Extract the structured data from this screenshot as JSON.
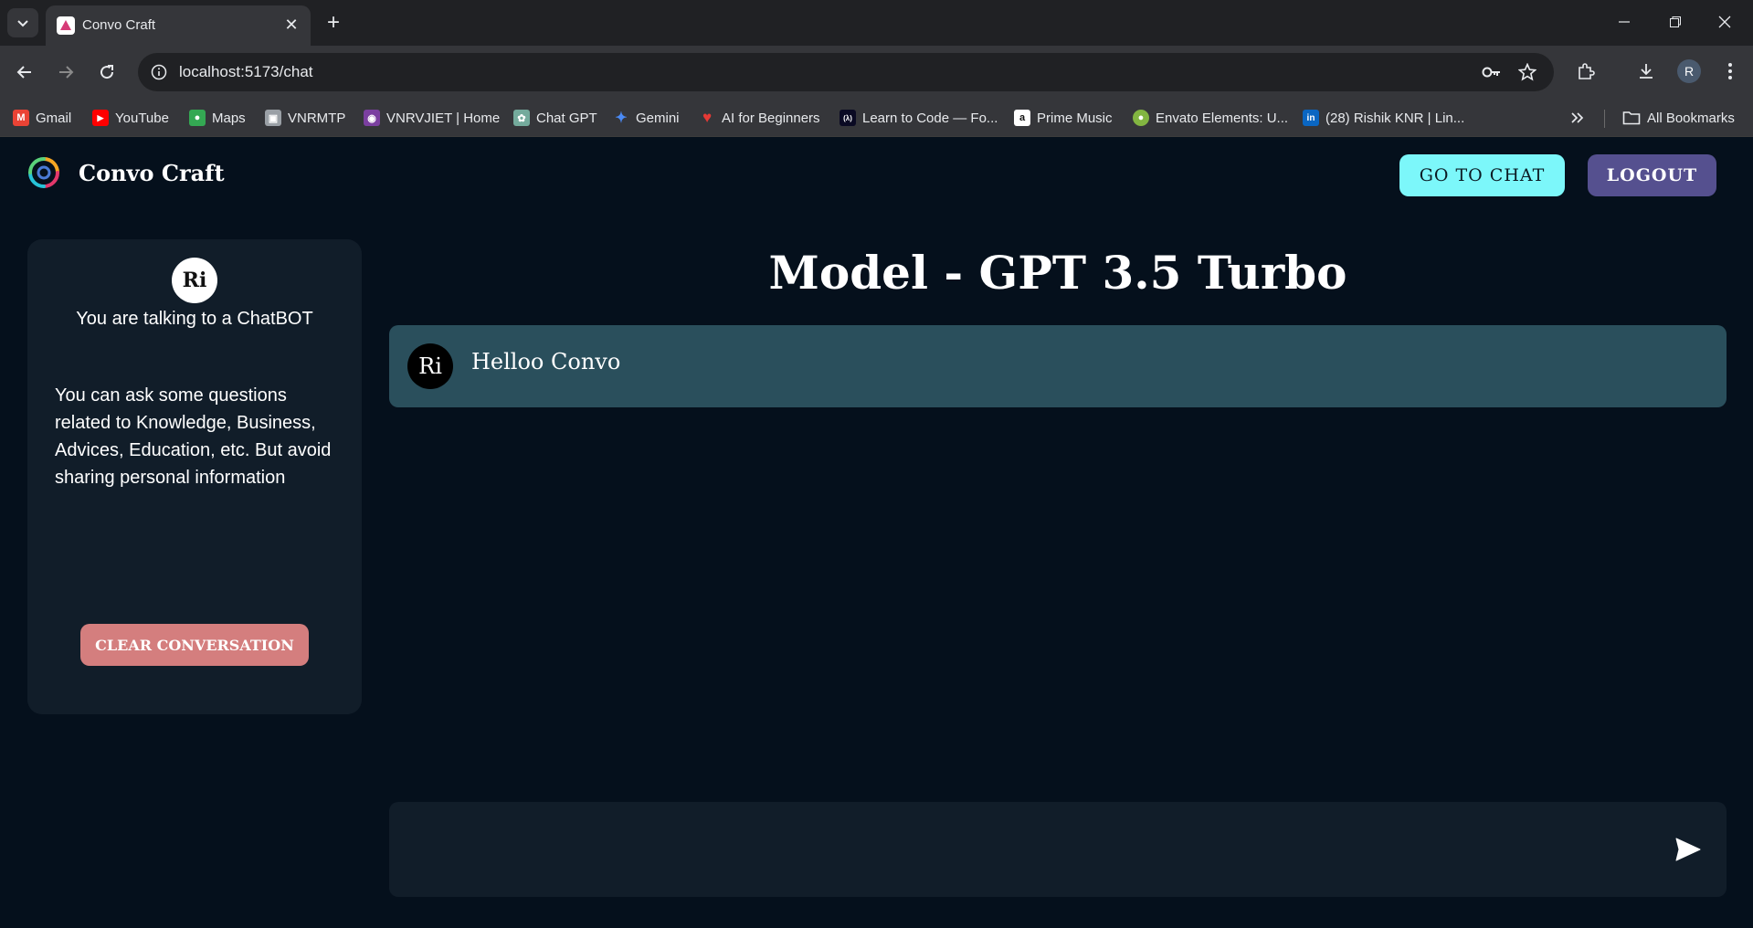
{
  "browser": {
    "tab_title": "Convo Craft",
    "url": "localhost:5173/chat",
    "profile_initial": "R",
    "bookmarks": [
      {
        "label": "Gmail",
        "color": "#ea4335",
        "icon": "M"
      },
      {
        "label": "YouTube",
        "color": "#ff0000",
        "icon": "▶"
      },
      {
        "label": "Maps",
        "color": "#34a853",
        "icon": "●"
      },
      {
        "label": "VNRMTP",
        "color": "#9aa0a6",
        "icon": "▣"
      },
      {
        "label": "VNRVJIET | Home",
        "color": "#7b3fa0",
        "icon": "◉"
      },
      {
        "label": "Chat GPT",
        "color": "#74aa9c",
        "icon": "✿"
      },
      {
        "label": "Gemini",
        "color": "#4a8af4",
        "icon": "✦"
      },
      {
        "label": "AI for Beginners",
        "color": "#e53935",
        "icon": "♥"
      },
      {
        "label": "Learn to Code — Fo...",
        "color": "#0a0a23",
        "icon": "(λ)"
      },
      {
        "label": "Prime Music",
        "color": "#ffffff",
        "icon": "a"
      },
      {
        "label": "Envato Elements: U...",
        "color": "#82b541",
        "icon": "●"
      },
      {
        "label": "(28) Rishik KNR | Lin...",
        "color": "#0a66c2",
        "icon": "in"
      }
    ],
    "all_bookmarks_label": "All Bookmarks"
  },
  "header": {
    "brand": "Convo Craft",
    "go_to_chat_label": "GO TO CHAT",
    "logout_label": "LOGOUT"
  },
  "sidebar": {
    "avatar_initials": "Ri",
    "title": "You are talking to a ChatBOT",
    "description": "You can ask some questions related to Knowledge, Business, Advices, Education, etc. But avoid sharing personal information",
    "clear_label": "CLEAR CONVERSATION"
  },
  "chat": {
    "model_title": "Model - GPT 3.5 Turbo",
    "messages": [
      {
        "avatar_initials": "Ri",
        "text": "Helloo Convo"
      }
    ],
    "input_value": "",
    "input_placeholder": ""
  },
  "colors": {
    "background": "#05101c",
    "panel": "#111d29",
    "message_bg": "#2a4f5c",
    "go_to_chat": "#7cf7fa",
    "logout": "#55508f",
    "clear": "#d47e7e"
  }
}
